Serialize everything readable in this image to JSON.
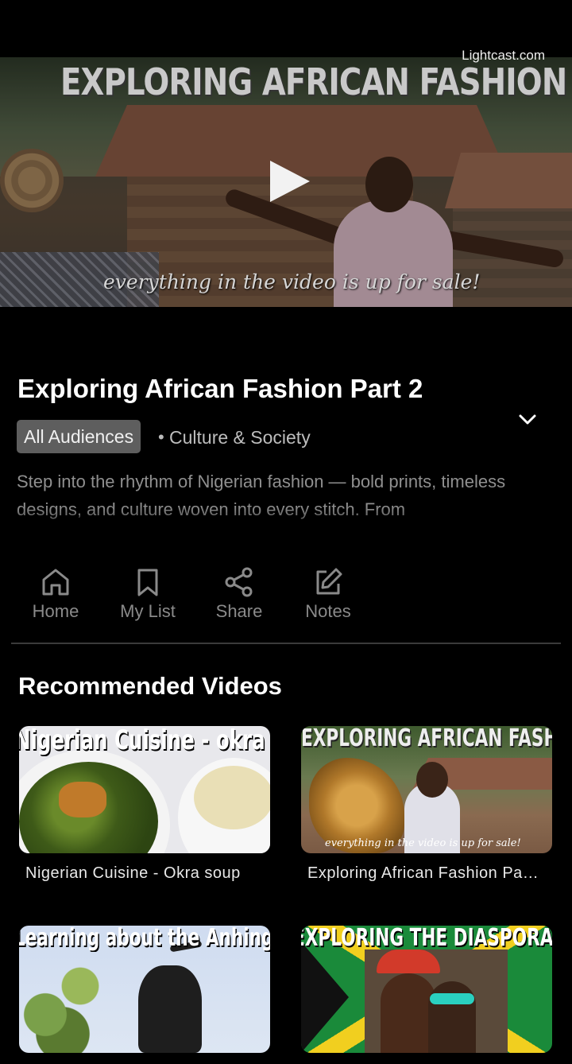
{
  "player": {
    "watermark": "Lightcast.com",
    "video_overlay_title": "EXPLORING AFRICAN FASHION",
    "video_overlay_caption": "everything in the video is up for sale!"
  },
  "details": {
    "title": "Exploring African Fashion Part 2",
    "audience_badge": "All Audiences",
    "separator": "•",
    "category": "Culture & Society",
    "description": "Step into the rhythm of Nigerian fashion — bold prints, timeless designs, and culture woven into every stitch. From"
  },
  "actions": [
    {
      "label": "Home",
      "icon": "home-icon"
    },
    {
      "label": "My List",
      "icon": "bookmark-icon"
    },
    {
      "label": "Share",
      "icon": "share-icon"
    },
    {
      "label": "Notes",
      "icon": "edit-icon"
    }
  ],
  "recommended": {
    "heading": "Recommended Videos",
    "items": [
      {
        "label": "Nigerian Cuisine - Okra soup",
        "thumb_text": "Nigerian Cuisine - okra so"
      },
      {
        "label": "Exploring African Fashion Pa…",
        "thumb_text": "EXPLORING AFRICAN FASHION",
        "thumb_caption": "everything in the video is up for sale!"
      },
      {
        "label": "",
        "thumb_text": "Learning about the Anhinga Bi"
      },
      {
        "label": "",
        "thumb_text": "EXPLORING THE DIASPORA IN JAMA"
      }
    ]
  },
  "colors": {
    "background": "#000000",
    "badge": "#5e5e5e",
    "muted_text": "#8a8a8a"
  }
}
